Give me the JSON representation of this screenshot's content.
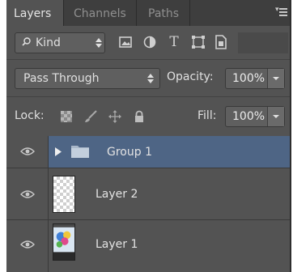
{
  "tabs": [
    {
      "label": "Layers",
      "active": true
    },
    {
      "label": "Channels",
      "active": false
    },
    {
      "label": "Paths",
      "active": false
    }
  ],
  "filter": {
    "kind_label": "Kind",
    "icons": [
      "image-filter-icon",
      "adjustment-filter-icon",
      "type-filter-icon",
      "shape-filter-icon",
      "smart-object-filter-icon"
    ],
    "type_glyph": "T"
  },
  "blend": {
    "mode": "Pass Through",
    "opacity_label": "Opacity:",
    "opacity_value": "100%"
  },
  "lock": {
    "label": "Lock:",
    "fill_label": "Fill:",
    "fill_value": "100%"
  },
  "layers": [
    {
      "name": "Group 1",
      "type": "group",
      "selected": true,
      "visible": true
    },
    {
      "name": "Layer 2",
      "type": "layer",
      "selected": false,
      "visible": true
    },
    {
      "name": "Layer 1",
      "type": "layer",
      "selected": false,
      "visible": true
    }
  ],
  "colors": {
    "panel_bg": "#535353",
    "tabbar_bg": "#3e3e3e",
    "selection": "#4e6585"
  }
}
